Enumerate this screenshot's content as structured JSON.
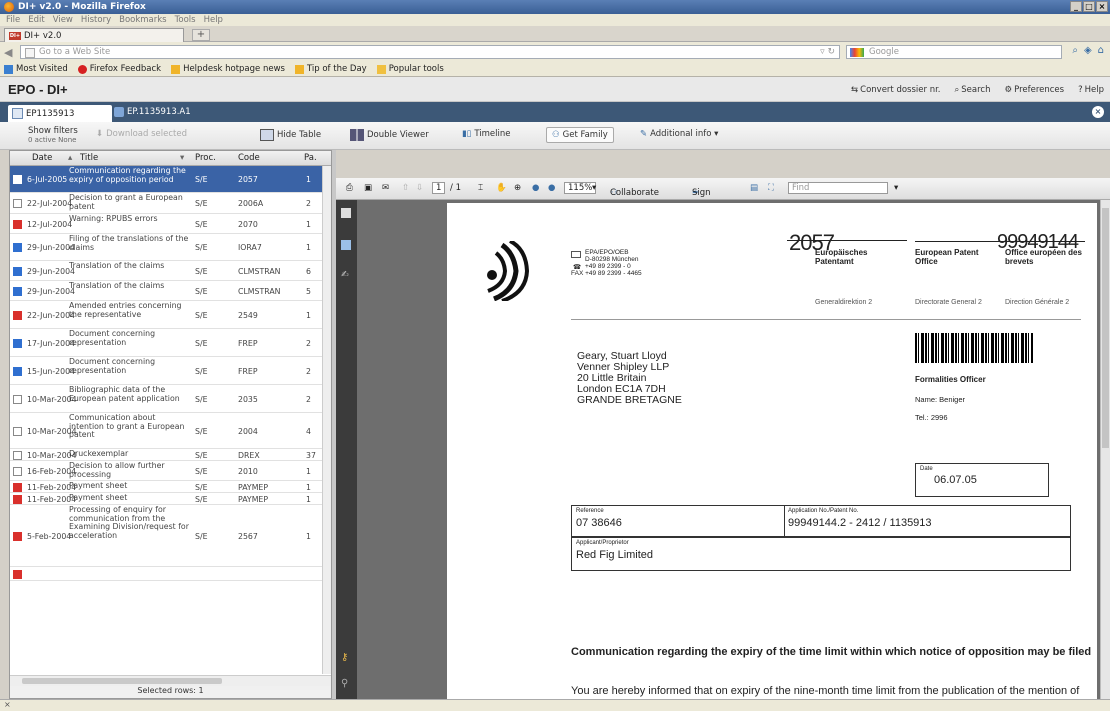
{
  "window": {
    "title": "DI+ v2.0 - Mozilla Firefox",
    "controls": [
      "_",
      "□",
      "×"
    ]
  },
  "menu": [
    "File",
    "Edit",
    "View",
    "History",
    "Bookmarks",
    "Tools",
    "Help"
  ],
  "browser_tab": {
    "label": "DI+ v2.0",
    "favicon": "DI+",
    "new_tab": "+"
  },
  "nav": {
    "url_placeholder": "Go to a Web Site",
    "search_placeholder": "Google"
  },
  "bookmarks": [
    {
      "label": "Most Visited",
      "color": "#3a7fd0"
    },
    {
      "label": "Firefox Feedback",
      "color": "#d62020"
    },
    {
      "label": "Helpdesk hotpage news",
      "color": "#f0b429"
    },
    {
      "label": "Tip of the Day",
      "color": "#f0b429"
    },
    {
      "label": "Popular tools",
      "color": "#f0c040"
    }
  ],
  "app": {
    "name": "EPO - DI+",
    "actions": {
      "convert": "Convert dossier nr.",
      "search": "Search",
      "preferences": "Preferences",
      "help": "Help"
    }
  },
  "dossier_tabs": {
    "tab1": "EP1135913",
    "tab2": "EP.1135913.A1"
  },
  "toolbar": {
    "show_filters": "Show filters",
    "active_none": "0 active None",
    "download": "Download selected",
    "hide_table": "Hide Table",
    "double_viewer": "Double Viewer",
    "timeline": "Timeline",
    "get_family": "Get Family",
    "additional_info": "Additional info ▾"
  },
  "table": {
    "headers": {
      "date": "Date",
      "title": "Title",
      "proc": "Proc.",
      "code": "Code",
      "pa": "Pa."
    },
    "rows": [
      {
        "date": "6-Jul-2005",
        "title": "Communication regarding the expiry of opposition period",
        "proc": "S/E",
        "code": "2057",
        "pa": "1",
        "icon": "red",
        "h": 27,
        "selected": true
      },
      {
        "date": "22-Jul-2004",
        "title": "Decision to grant a European patent",
        "proc": "S/E",
        "code": "2006A",
        "pa": "2",
        "icon": "gray",
        "h": 21
      },
      {
        "date": "12-Jul-2004",
        "title": "Warning: RPUBS errors",
        "proc": "S/E",
        "code": "2070",
        "pa": "1",
        "icon": "red",
        "h": 20
      },
      {
        "date": "29-Jun-2004",
        "title": "Filing of the translations of the claims",
        "proc": "S/E",
        "code": "IORA7",
        "pa": "1",
        "icon": "blue",
        "h": 27
      },
      {
        "date": "29-Jun-2004",
        "title": "Translation of the claims",
        "proc": "S/E",
        "code": "CLMSTRAN",
        "pa": "6",
        "icon": "blue",
        "h": 20
      },
      {
        "date": "29-Jun-2004",
        "title": "Translation of the claims",
        "proc": "S/E",
        "code": "CLMSTRAN",
        "pa": "5",
        "icon": "blue",
        "h": 20
      },
      {
        "date": "22-Jun-2004",
        "title": "Amended entries concerning the representative",
        "proc": "S/E",
        "code": "2549",
        "pa": "1",
        "icon": "red",
        "h": 28
      },
      {
        "date": "17-Jun-2004",
        "title": "Document concerning representation",
        "proc": "S/E",
        "code": "FREP",
        "pa": "2",
        "icon": "blue",
        "h": 28
      },
      {
        "date": "15-Jun-2004",
        "title": "Document concerning representation",
        "proc": "S/E",
        "code": "FREP",
        "pa": "2",
        "icon": "blue",
        "h": 28
      },
      {
        "date": "10-Mar-2004",
        "title": "Bibliographic data of the European patent application",
        "proc": "S/E",
        "code": "2035",
        "pa": "2",
        "icon": "gray",
        "h": 28
      },
      {
        "date": "10-Mar-2004",
        "title": "Communication about intention to grant a European patent",
        "proc": "S/E",
        "code": "2004",
        "pa": "4",
        "icon": "gray",
        "h": 36
      },
      {
        "date": "10-Mar-2004",
        "title": "Druckexemplar",
        "proc": "S/E",
        "code": "DREX",
        "pa": "37",
        "icon": "gray",
        "h": 12
      },
      {
        "date": "16-Feb-2004",
        "title": "Decision to allow further processing",
        "proc": "S/E",
        "code": "2010",
        "pa": "1",
        "icon": "gray",
        "h": 20
      },
      {
        "date": "11-Feb-2004",
        "title": "Payment sheet",
        "proc": "S/E",
        "code": "PAYMEP",
        "pa": "1",
        "icon": "red",
        "h": 12
      },
      {
        "date": "11-Feb-2004",
        "title": "Payment sheet",
        "proc": "S/E",
        "code": "PAYMEP",
        "pa": "1",
        "icon": "red",
        "h": 12
      },
      {
        "date": "5-Feb-2004",
        "title": "Processing of enquiry for communication from the Examining Division/request for acceleration",
        "proc": "S/E",
        "code": "2567",
        "pa": "1",
        "icon": "red",
        "h": 62
      },
      {
        "date": "",
        "title": "",
        "proc": "",
        "code": "",
        "pa": "",
        "icon": "red",
        "h": 14
      }
    ],
    "selected_rows": "Selected rows: 1"
  },
  "pdf_toolbar": {
    "page_current": "1",
    "page_total": "/ 1",
    "zoom": "115%",
    "collaborate": "Collaborate ▾",
    "sign": "Sign ▾",
    "find": "Find"
  },
  "pdf": {
    "code_stamp": "2057",
    "number_stamp": "99949144",
    "office_de": "Europäisches Patentamt",
    "office_en": "European Patent Office",
    "office_fr": "Office européen des brevets",
    "sender": [
      "EPA/EPO/OEB",
      "D-80298 München",
      "+49 89 2399 - 0",
      "FAX +49 89 2399 - 4465"
    ],
    "dg_de": "Generaldirektion 2",
    "dg_en": "Directorate General 2",
    "dg_fr": "Direction Générale 2",
    "address": [
      "Geary, Stuart Lloyd",
      "Venner Shipley LLP",
      "20 Little Britain",
      "London EC1A 7DH",
      "GRANDE BRETAGNE"
    ],
    "officer_title": "Formalities Officer",
    "officer_name": "Name: Beniger",
    "officer_tel": "Tel.: 2996",
    "date_label": "Date",
    "date_value": "06.07.05",
    "ref_label": "Reference",
    "ref_value": "07 38646",
    "app_label": "Application No./Patent No.",
    "app_value": "99949144.2 - 2412 / 1135913",
    "applicant_label": "Applicant/Proprietor",
    "applicant_value": "Red Fig Limited",
    "heading": "Communication regarding the expiry of the time limit within which notice of opposition may be filed",
    "body_line": "You are hereby informed that on expiry of the nine-month time limit from the publication of the mention of"
  },
  "status": {
    "text": "×"
  }
}
